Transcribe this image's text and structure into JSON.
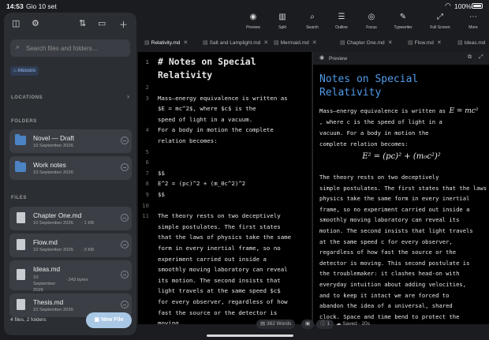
{
  "status": {
    "time": "14:53",
    "date": "Gio 10 set",
    "battery": "100%"
  },
  "toolbar": [
    {
      "name": "preview",
      "label": "Preview",
      "icon": "eye-icon",
      "glyph": "◉"
    },
    {
      "name": "split",
      "label": "Split",
      "icon": "split-icon",
      "glyph": "▥"
    },
    {
      "name": "search",
      "label": "Search",
      "icon": "search-icon",
      "glyph": "⌕"
    },
    {
      "name": "outline",
      "label": "Outline",
      "icon": "outline-icon",
      "glyph": "☰"
    },
    {
      "name": "focus",
      "label": "Focus",
      "icon": "focus-icon",
      "glyph": "◎"
    },
    {
      "name": "typewriter",
      "label": "Typewriter",
      "icon": "typewriter-icon",
      "glyph": "✎"
    },
    {
      "name": "fullscreen",
      "label": "Full Screen",
      "icon": "fullscreen-icon",
      "glyph": "⤢"
    },
    {
      "name": "more",
      "label": "More",
      "icon": "more-icon",
      "glyph": "⋯"
    }
  ],
  "tabs": [
    {
      "label": "Relativity.md",
      "active": true
    },
    {
      "label": "Salt and Lamplight.md",
      "active": false
    },
    {
      "label": "Mermaid.md",
      "active": false
    },
    {
      "label": "Chapter One.md",
      "active": false
    },
    {
      "label": "Flow.md",
      "active": false
    },
    {
      "label": "Ideas.md",
      "active": false
    }
  ],
  "editor": {
    "lines": [
      {
        "num": "1",
        "text": "# Notes on Special",
        "h1": true
      },
      {
        "num": "",
        "text": "Relativity",
        "h1": true
      },
      {
        "num": "2",
        "text": ""
      },
      {
        "num": "3",
        "text": "Mass–energy equivalence is written as"
      },
      {
        "num": "",
        "text": "$E = mc^2$, where $c$ is the"
      },
      {
        "num": "",
        "text": "speed of light in a vacuum."
      },
      {
        "num": "4",
        "text": "For a body in motion the complete"
      },
      {
        "num": "",
        "text": "relation becomes:"
      },
      {
        "num": "5",
        "text": ""
      },
      {
        "num": "6",
        "text": ""
      },
      {
        "num": "7",
        "text": "$$"
      },
      {
        "num": "8",
        "text": "E^2 = (pc)^2 + (m_0c^2)^2"
      },
      {
        "num": "9",
        "text": "$$"
      },
      {
        "num": "10",
        "text": ""
      },
      {
        "num": "11",
        "text": "The theory rests on two deceptively"
      },
      {
        "num": "",
        "text": "simple postulates. The first states"
      },
      {
        "num": "",
        "text": "that the laws of physics take the same"
      },
      {
        "num": "",
        "text": "form in every inertial frame, so no"
      },
      {
        "num": "",
        "text": "experiment carried out inside a"
      },
      {
        "num": "",
        "text": "smoothly moving laboratory can reveal"
      },
      {
        "num": "",
        "text": "its motion. The second insists that"
      },
      {
        "num": "",
        "text": "light travels at the same speed $c$"
      },
      {
        "num": "",
        "text": "for every observer, regardless of how"
      },
      {
        "num": "",
        "text": "fast the source or the detector is"
      },
      {
        "num": "",
        "text": "moving."
      },
      {
        "num": "12",
        "text": "This second postulate is the"
      }
    ]
  },
  "preview": {
    "header_label": "Preview",
    "title": "Notes on Special Relativity",
    "lines_a": [
      "Mass–energy equivalence is written as",
      ", where c is the speed of light in a",
      "vacuum. For a body in motion the",
      "complete relation becomes:"
    ],
    "inline_formula": "E = mc²",
    "formula": "E² = (pc)² + (m₀c²)²",
    "lines_b": [
      "The theory rests on two deceptively",
      "simple postulates. The first states that the laws of",
      "physics take the same form in every inertial",
      "frame, so no experiment carried out inside a",
      "smoothly moving laboratory can reveal its",
      "motion. The second insists that light travels",
      "at the same speed c for every observer,",
      "regardless of how fast the source or the",
      "detector is moving. This second postulate is",
      "the troublemaker: it clashes head-on with",
      "everyday intuition about adding velocities,",
      "and to keep it intact we are forced to",
      "abandon the idea of a universal, shared",
      "clock. Space and time bend to protect the"
    ]
  },
  "bottom": {
    "words": "362 Words",
    "count": "1",
    "saved": "Saved · 20s"
  },
  "sidebar": {
    "search_placeholder": "Search files and folders...",
    "tag": "Inkiostro",
    "locations": "LOCATIONS",
    "folders_heading": "FOLDERS",
    "files_heading": "FILES",
    "folders": [
      {
        "name": "Novel — Draft",
        "date": "10 September 2026"
      },
      {
        "name": "Work notes",
        "date": "10 September 2026"
      }
    ],
    "files": [
      {
        "name": "Chapter One.md",
        "date": "10 September 2026",
        "meta": "· 1 KB"
      },
      {
        "name": "Flow.md",
        "date": "10 September 2026",
        "meta": "· 3 KB"
      },
      {
        "name": "Ideas.md",
        "date": "10 September 2026",
        "meta": "· 243 bytes"
      },
      {
        "name": "Thesis.md",
        "date": "10 September 2026",
        "meta": ""
      }
    ],
    "footer": "4 files, 2 folders",
    "new_file": "New File"
  }
}
